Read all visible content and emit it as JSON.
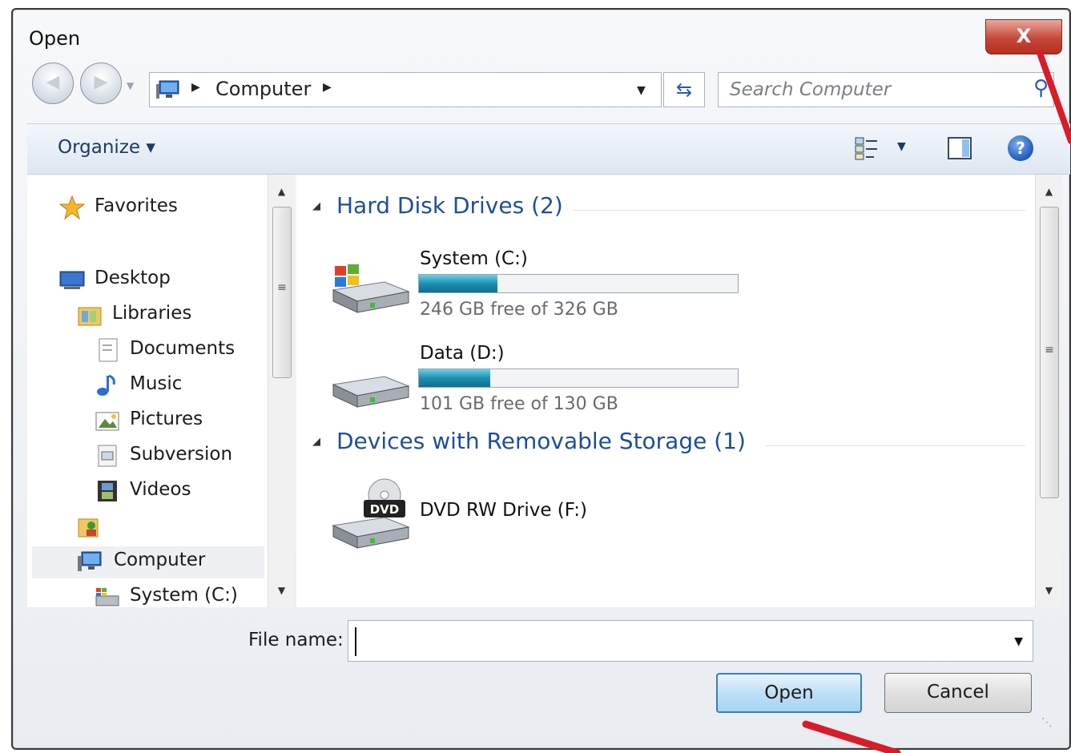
{
  "window": {
    "title": "Open",
    "close_label": "X"
  },
  "nav": {
    "back_icon": "back-arrow-icon",
    "forward_icon": "forward-arrow-icon",
    "breadcrumb": "Computer",
    "refresh_icon": "refresh-icon",
    "search_placeholder": "Search Computer"
  },
  "toolbar": {
    "organize_label": "Organize",
    "views_icon": "views-icon",
    "preview_icon": "preview-pane-icon",
    "help_label": "?"
  },
  "sidebar": {
    "items": [
      {
        "label": "Favorites",
        "icon": "star-icon"
      },
      {
        "label": "Desktop",
        "icon": "desktop-icon"
      },
      {
        "label": "Libraries",
        "icon": "libraries-icon"
      },
      {
        "label": "Documents",
        "icon": "documents-icon"
      },
      {
        "label": "Music",
        "icon": "music-icon"
      },
      {
        "label": "Pictures",
        "icon": "pictures-icon"
      },
      {
        "label": "Subversion",
        "icon": "subversion-icon"
      },
      {
        "label": "Videos",
        "icon": "videos-icon"
      },
      {
        "label": "",
        "icon": "user-folder-icon"
      },
      {
        "label": "Computer",
        "icon": "computer-icon",
        "selected": true
      },
      {
        "label": "System (C:)",
        "icon": "system-drive-icon"
      }
    ]
  },
  "content": {
    "groups": [
      {
        "title": "Hard Disk Drives (2)",
        "drives": [
          {
            "name": "System (C:)",
            "free_text": "246 GB free of 326 GB",
            "used_fraction": 0.245,
            "icon": "windows-drive-icon"
          },
          {
            "name": "Data (D:)",
            "free_text": "101 GB free of 130 GB",
            "used_fraction": 0.223,
            "icon": "hard-drive-icon"
          }
        ]
      },
      {
        "title": "Devices with Removable Storage (1)",
        "drives": [
          {
            "name": "DVD RW Drive (F:)",
            "icon": "dvd-drive-icon",
            "dvd_label": "DVD"
          }
        ]
      }
    ]
  },
  "footer": {
    "filename_label": "File name:",
    "filename_value": "",
    "open_label": "Open",
    "cancel_label": "Cancel"
  },
  "colors": {
    "group_title": "#1e4e9c",
    "annotation": "#d81c2a",
    "progress": "#1b8fb2"
  }
}
